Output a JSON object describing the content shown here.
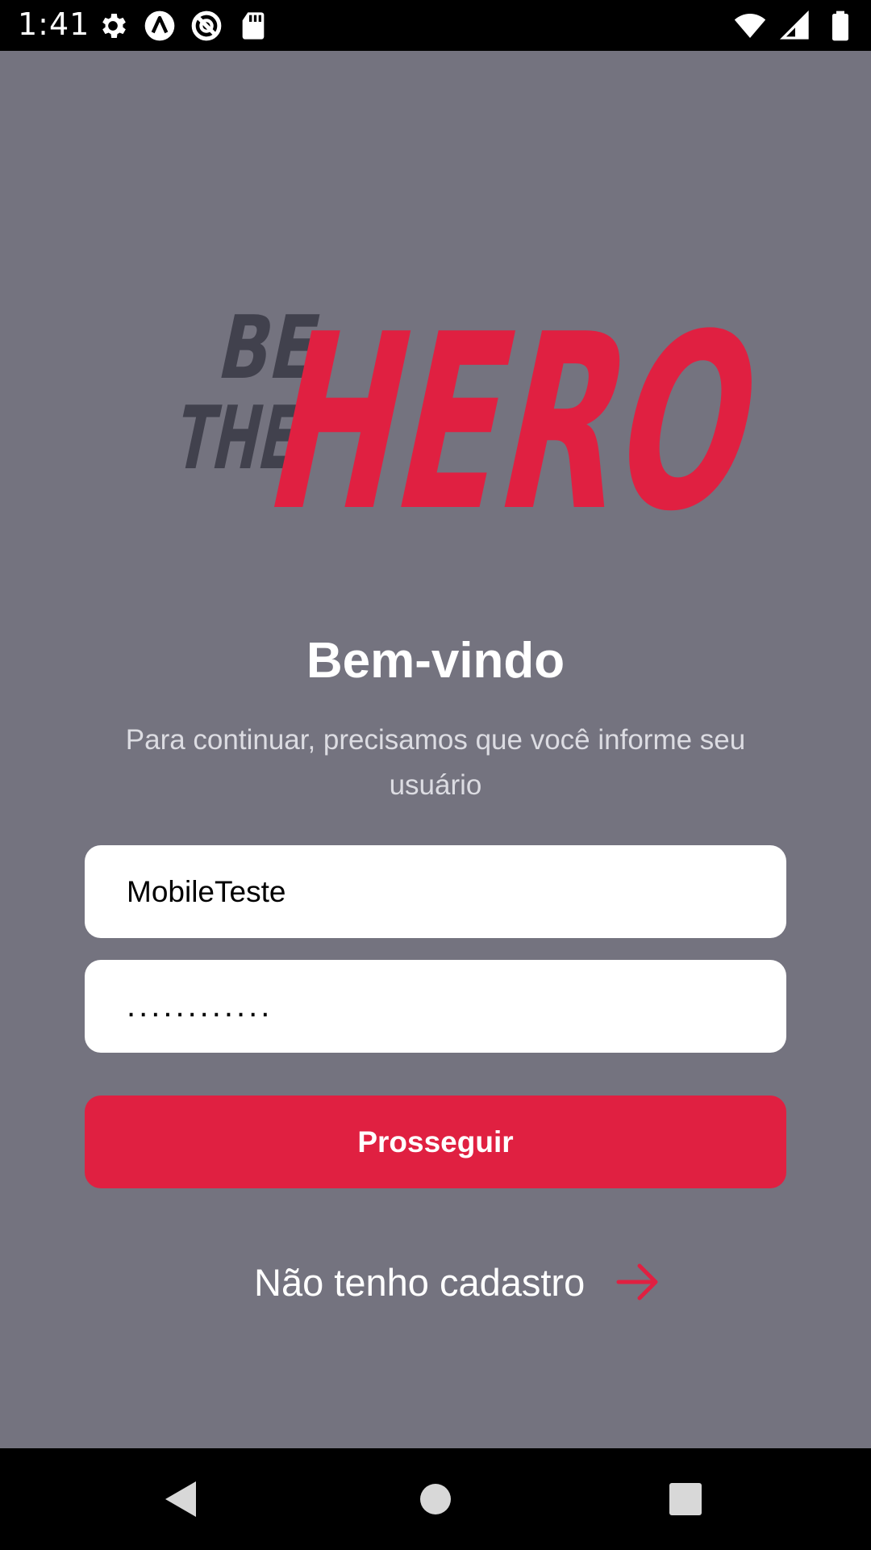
{
  "status_bar": {
    "time": "1:41",
    "left_icons": [
      "settings-icon",
      "app-a-icon",
      "blocked-notification-icon",
      "sd-card-icon"
    ],
    "right_icons": [
      "wifi-icon",
      "cell-signal-icon",
      "battery-icon"
    ]
  },
  "logo": {
    "text_small_1": "BE",
    "text_small_2": "THE",
    "text_big": "HERO",
    "color_dark": "#41414d",
    "color_brand": "#e02041"
  },
  "welcome": {
    "title": "Bem-vindo",
    "subtitle": "Para continuar, precisamos que você informe seu usuário"
  },
  "form": {
    "username_value": "MobileTeste",
    "password_value": "............",
    "submit_label": "Prosseguir"
  },
  "register": {
    "label": "Não tenho cadastro",
    "icon": "arrow-right-icon"
  },
  "nav_bar": {
    "buttons": [
      "back-icon",
      "home-icon",
      "recents-icon"
    ]
  },
  "colors": {
    "background": "#74737f",
    "accent": "#e02041",
    "input_bg": "#ffffff"
  }
}
